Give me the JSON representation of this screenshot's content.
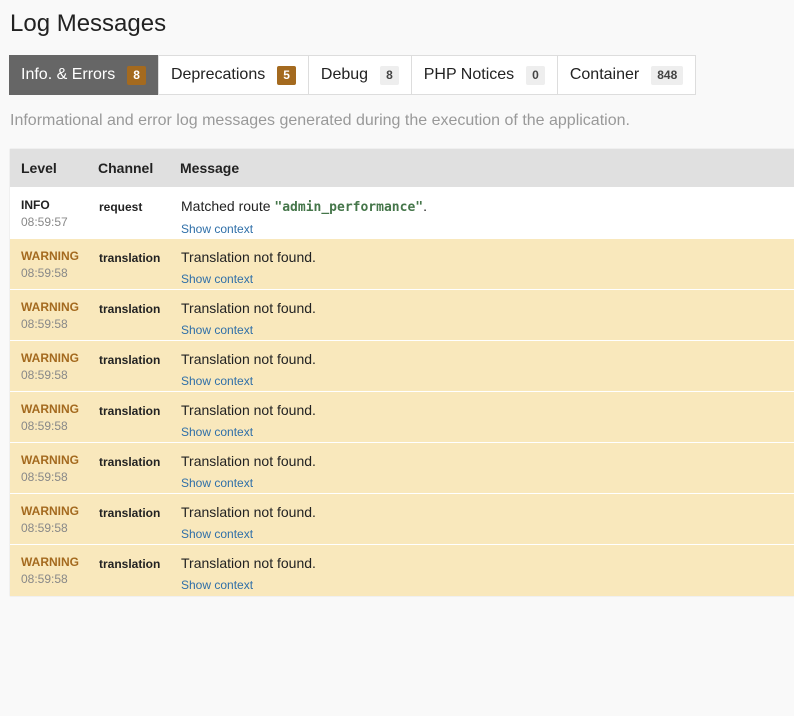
{
  "title": "Log Messages",
  "tabs": [
    {
      "label": "Info. & Errors",
      "count": "8",
      "active": true,
      "warn": true
    },
    {
      "label": "Deprecations",
      "count": "5",
      "active": false,
      "warn": true
    },
    {
      "label": "Debug",
      "count": "8",
      "active": false,
      "warn": false
    },
    {
      "label": "PHP Notices",
      "count": "0",
      "active": false,
      "warn": false
    },
    {
      "label": "Container",
      "count": "848",
      "active": false,
      "warn": false
    }
  ],
  "description": "Informational and error log messages generated during the execution of the application.",
  "table": {
    "headers": {
      "level": "Level",
      "channel": "Channel",
      "message": "Message"
    },
    "rows": [
      {
        "level": "INFO",
        "time": "08:59:57",
        "channel": "request",
        "message_prefix": "Matched route ",
        "message_code": "\"admin_performance\"",
        "message_suffix": ".",
        "context_link": "Show context"
      },
      {
        "level": "WARNING",
        "time": "08:59:58",
        "channel": "translation",
        "message_prefix": "Translation not found.",
        "message_code": "",
        "message_suffix": "",
        "context_link": "Show context"
      },
      {
        "level": "WARNING",
        "time": "08:59:58",
        "channel": "translation",
        "message_prefix": "Translation not found.",
        "message_code": "",
        "message_suffix": "",
        "context_link": "Show context"
      },
      {
        "level": "WARNING",
        "time": "08:59:58",
        "channel": "translation",
        "message_prefix": "Translation not found.",
        "message_code": "",
        "message_suffix": "",
        "context_link": "Show context"
      },
      {
        "level": "WARNING",
        "time": "08:59:58",
        "channel": "translation",
        "message_prefix": "Translation not found.",
        "message_code": "",
        "message_suffix": "",
        "context_link": "Show context"
      },
      {
        "level": "WARNING",
        "time": "08:59:58",
        "channel": "translation",
        "message_prefix": "Translation not found.",
        "message_code": "",
        "message_suffix": "",
        "context_link": "Show context"
      },
      {
        "level": "WARNING",
        "time": "08:59:58",
        "channel": "translation",
        "message_prefix": "Translation not found.",
        "message_code": "",
        "message_suffix": "",
        "context_link": "Show context"
      },
      {
        "level": "WARNING",
        "time": "08:59:58",
        "channel": "translation",
        "message_prefix": "Translation not found.",
        "message_code": "",
        "message_suffix": "",
        "context_link": "Show context"
      }
    ]
  },
  "colors": {
    "active_tab_bg": "#666666",
    "warning_badge": "#a46a1f",
    "warning_row_bg": "#f9e8bc",
    "code_green": "#45764a",
    "link_blue": "#2f6fa8"
  }
}
